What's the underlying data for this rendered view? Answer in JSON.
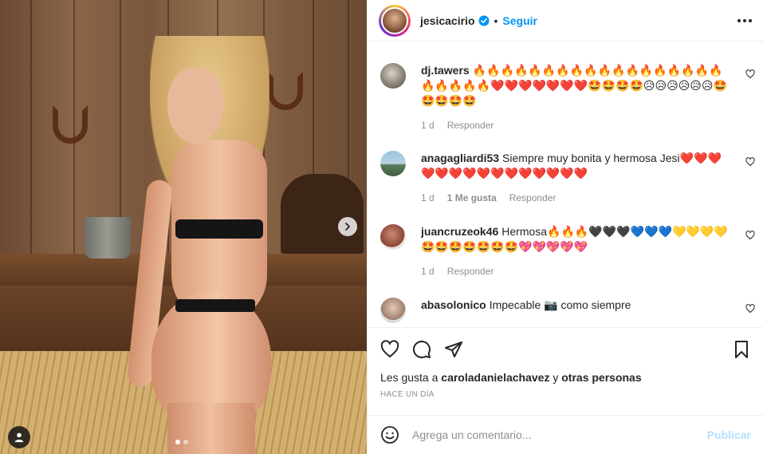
{
  "post": {
    "image_alt": "",
    "carousel_pages": 2,
    "carousel_current": 1
  },
  "header": {
    "username": "jesicacirio",
    "separator": "•",
    "follow_label": "Seguir"
  },
  "comments": [
    {
      "username": "dj.tawers",
      "text": "🔥🔥🔥🔥🔥🔥🔥🔥🔥🔥🔥🔥🔥🔥🔥🔥🔥🔥🔥🔥🔥🔥🔥❤️❤️❤️❤️❤️❤️❤️🤩🤩🤩🤩😥😥😥😥😥😥🤩🤩🤩🤩🤩",
      "time": "1 d",
      "likes": "",
      "reply_label": "Responder"
    },
    {
      "username": "anagagliardi53",
      "text": "Siempre muy bonita y hermosa Jesi❤️❤️❤️❤️❤️❤️❤️❤️❤️❤️❤️❤️❤️❤️❤️",
      "time": "1 d",
      "likes": "1 Me gusta",
      "reply_label": "Responder"
    },
    {
      "username": "juancruzeok46",
      "text": "Hermosa🔥🔥🔥🖤🖤🖤💙💙💙💛💛💛💛🤩🤩🤩🤩🤩🤩🤩💖💖💖💖💖",
      "time": "1 d",
      "likes": "",
      "reply_label": "Responder"
    },
    {
      "username": "abasolonico",
      "text": "Impecable 📷 como siempre",
      "time": "",
      "likes": "",
      "reply_label": ""
    }
  ],
  "likes": {
    "prefix": "Les gusta a",
    "user": "caroladanielachavez",
    "connector": "y",
    "others": "otras personas"
  },
  "timestamp": "HACE UN DÍA",
  "add_comment": {
    "placeholder": "Agrega un comentario...",
    "publish_label": "Publicar"
  },
  "colors": {
    "accent": "#0095f6",
    "publish_disabled": "#b2dffc",
    "muted": "#8e8e8e",
    "text": "#262626"
  }
}
